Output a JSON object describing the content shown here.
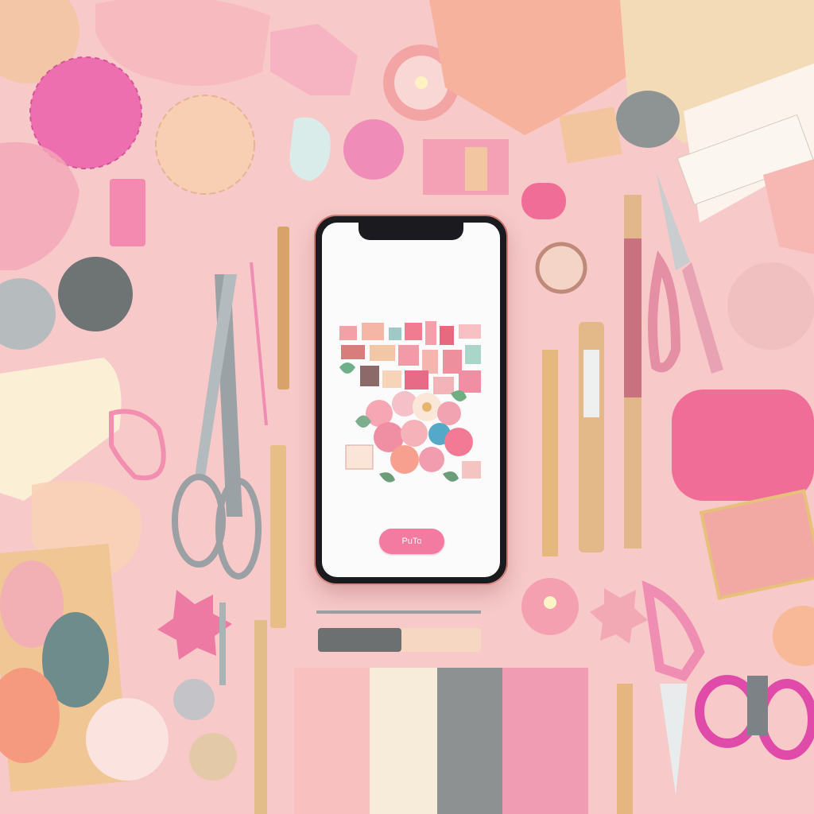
{
  "screen": {
    "button_label": "PuTo"
  },
  "colors": {
    "background": "#f7c9c9",
    "accent_pink": "#f37aa0",
    "phone_frame": "#1b1b1f",
    "screen": "#fbfbfc"
  },
  "icons": [
    "scissors-icon",
    "yarn-ball-icon",
    "pencil-icon",
    "candle-icon",
    "ruler-icon",
    "flower-icon"
  ]
}
